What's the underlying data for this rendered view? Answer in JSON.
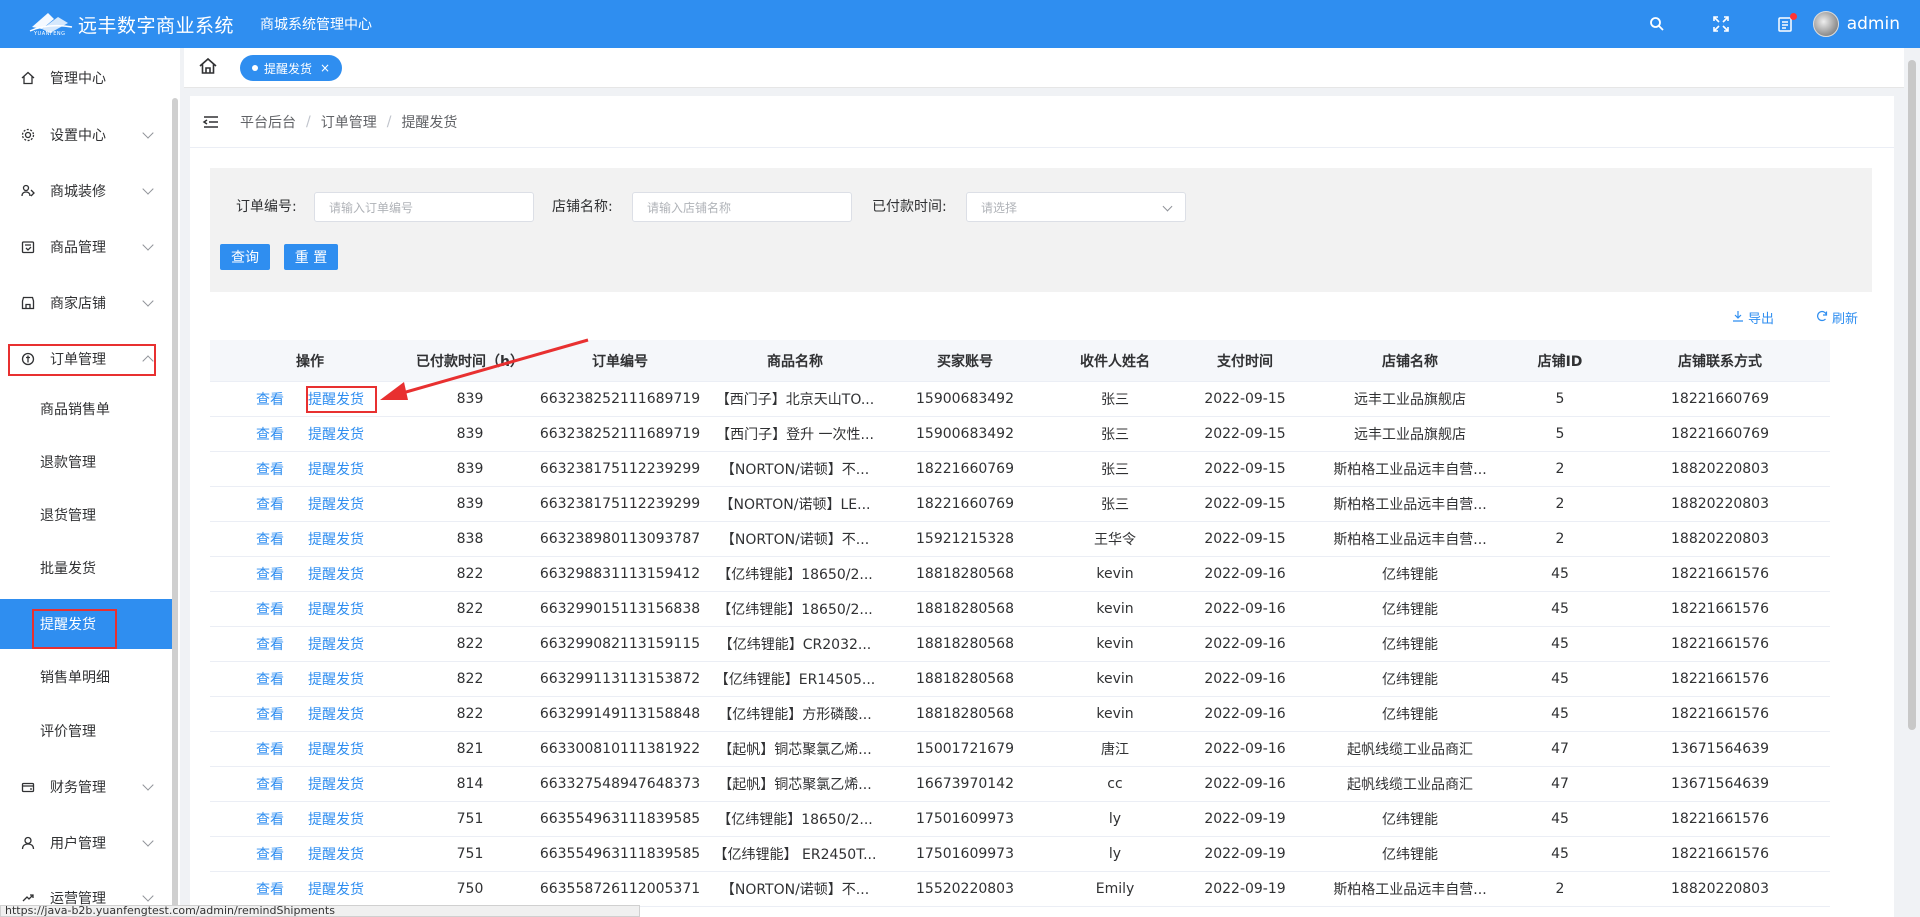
{
  "header": {
    "logo_text": "远丰数字商业系统",
    "logo_sub": "YUANFENG",
    "system_name": "商城系统管理中心",
    "user": "admin",
    "brand_color": "#2f8ef0"
  },
  "sidebar": {
    "items": [
      {
        "label": "管理中心",
        "icon": "home-icon"
      },
      {
        "label": "设置中心",
        "icon": "gear-icon"
      },
      {
        "label": "商城装修",
        "icon": "decorate-icon"
      },
      {
        "label": "商品管理",
        "icon": "goods-icon"
      },
      {
        "label": "商家店铺",
        "icon": "store-icon"
      },
      {
        "label": "订单管理",
        "icon": "order-icon"
      },
      {
        "label": "财务管理",
        "icon": "finance-icon"
      },
      {
        "label": "用户管理",
        "icon": "user-icon"
      },
      {
        "label": "运营管理",
        "icon": "operation-icon"
      }
    ],
    "sub_items": [
      "商品销售单",
      "退款管理",
      "退货管理",
      "批量发货",
      "提醒发货",
      "销售单明细",
      "评价管理"
    ]
  },
  "tabs": {
    "active_tab": "提醒发货",
    "close": "×"
  },
  "breadcrumb": [
    "平台后台",
    "订单管理",
    "提醒发货"
  ],
  "search": {
    "order_no_label": "订单编号:",
    "order_no_placeholder": "请输入订单编号",
    "store_label": "店铺名称:",
    "store_placeholder": "请输入店铺名称",
    "paid_label": "已付款时间:",
    "paid_placeholder": "请选择",
    "query_btn": "查询",
    "reset_btn": "重 置"
  },
  "tools": {
    "export": "导出",
    "refresh": "刷新"
  },
  "table": {
    "headers": [
      "操作",
      "已付款时间（h）",
      "订单编号",
      "商品名称",
      "买家账号",
      "收件人姓名",
      "支付时间",
      "店铺名称",
      "店铺ID",
      "店铺联系方式"
    ],
    "view_label": "查看",
    "remind_label": "提醒发货",
    "rows": [
      [
        "839",
        "663238252111689719",
        "【西门子】北京天山TO...",
        "15900683492",
        "张三",
        "2022-09-15",
        "远丰工业品旗舰店",
        "5",
        "18221660769"
      ],
      [
        "839",
        "663238252111689719",
        "【西门子】登升 一次性...",
        "15900683492",
        "张三",
        "2022-09-15",
        "远丰工业品旗舰店",
        "5",
        "18221660769"
      ],
      [
        "839",
        "663238175112239299",
        "【NORTON/诺顿】不...",
        "18221660769",
        "张三",
        "2022-09-15",
        "斯柏格工业品远丰自营...",
        "2",
        "18820220803"
      ],
      [
        "839",
        "663238175112239299",
        "【NORTON/诺顿】LE...",
        "18221660769",
        "张三",
        "2022-09-15",
        "斯柏格工业品远丰自营...",
        "2",
        "18820220803"
      ],
      [
        "838",
        "663238980113093787",
        "【NORTON/诺顿】不...",
        "15921215328",
        "王华令",
        "2022-09-15",
        "斯柏格工业品远丰自营...",
        "2",
        "18820220803"
      ],
      [
        "822",
        "663298831113159412",
        "【亿纬锂能】18650/2...",
        "18818280568",
        "kevin",
        "2022-09-16",
        "亿纬锂能",
        "45",
        "18221661576"
      ],
      [
        "822",
        "663299015113156838",
        "【亿纬锂能】18650/2...",
        "18818280568",
        "kevin",
        "2022-09-16",
        "亿纬锂能",
        "45",
        "18221661576"
      ],
      [
        "822",
        "663299082113159115",
        "【亿纬锂能】CR2032...",
        "18818280568",
        "kevin",
        "2022-09-16",
        "亿纬锂能",
        "45",
        "18221661576"
      ],
      [
        "822",
        "663299113113153872",
        "【亿纬锂能】ER14505...",
        "18818280568",
        "kevin",
        "2022-09-16",
        "亿纬锂能",
        "45",
        "18221661576"
      ],
      [
        "822",
        "663299149113158848",
        "【亿纬锂能】方形磷酸...",
        "18818280568",
        "kevin",
        "2022-09-16",
        "亿纬锂能",
        "45",
        "18221661576"
      ],
      [
        "821",
        "663300810111381922",
        "【起帆】铜芯聚氯乙烯...",
        "15001721679",
        "唐江",
        "2022-09-16",
        "起帆线缆工业品商汇",
        "47",
        "13671564639"
      ],
      [
        "814",
        "663327548947648373",
        "【起帆】铜芯聚氯乙烯...",
        "16673970142",
        "cc",
        "2022-09-16",
        "起帆线缆工业品商汇",
        "47",
        "13671564639"
      ],
      [
        "751",
        "663554963111839585",
        "【亿纬锂能】18650/2...",
        "17501609973",
        "ly",
        "2022-09-19",
        "亿纬锂能",
        "45",
        "18221661576"
      ],
      [
        "751",
        "663554963111839585",
        "【亿纬锂能】 ER2450T...",
        "17501609973",
        "ly",
        "2022-09-19",
        "亿纬锂能",
        "45",
        "18221661576"
      ],
      [
        "750",
        "663558726112005371",
        "【NORTON/诺顿】不...",
        "15520220803",
        "Emily",
        "2022-09-19",
        "斯柏格工业品远丰自营...",
        "2",
        "18820220803"
      ]
    ]
  },
  "status_url": "https://java-b2b.yuanfengtest.com/admin/remindShipments"
}
